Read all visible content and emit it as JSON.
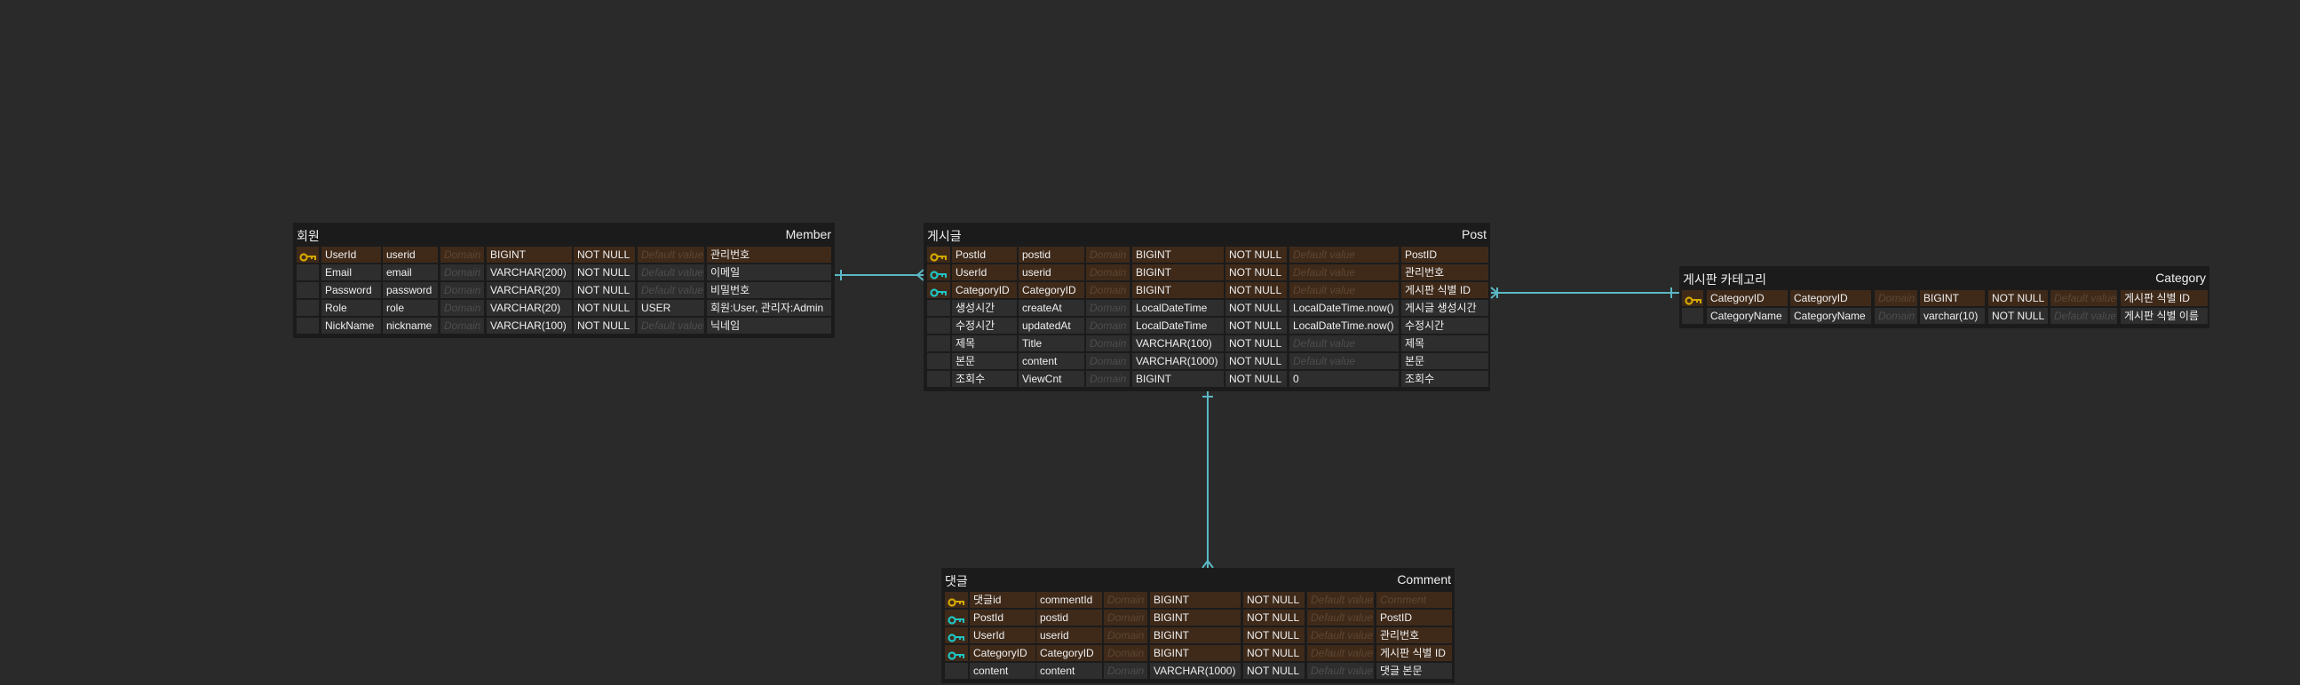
{
  "placeholders": {
    "domain": "Domain",
    "default": "Default value",
    "comment": "Comment"
  },
  "colors": {
    "background": "#2a2a2a",
    "table": "#1b1b1b",
    "key_row": "#3f2a1a",
    "pk_icon": "#d4a800",
    "fk_icon": "#1fc4c4",
    "relation_line": "#5bb8c4"
  },
  "tables": [
    {
      "id": "member",
      "logical_name": "회원",
      "physical_name": "Member",
      "rows": [
        {
          "key": "pk",
          "logical": "UserId",
          "physical": "userid",
          "type": "BIGINT",
          "null": "NOT NULL",
          "default": null,
          "comment": "관리번호"
        },
        {
          "key": null,
          "logical": "Email",
          "physical": "email",
          "type": "VARCHAR(200)",
          "null": "NOT NULL",
          "default": null,
          "comment": "이메일"
        },
        {
          "key": null,
          "logical": "Password",
          "physical": "password",
          "type": "VARCHAR(20)",
          "null": "NOT NULL",
          "default": null,
          "comment": "비밀번호"
        },
        {
          "key": null,
          "logical": "Role",
          "physical": "role",
          "type": "VARCHAR(20)",
          "null": "NOT NULL",
          "default": "USER",
          "comment": "회원:User, 관리자:Admin"
        },
        {
          "key": null,
          "logical": "NickName",
          "physical": "nickname",
          "type": "VARCHAR(100)",
          "null": "NOT NULL",
          "default": null,
          "comment": "닉네임"
        }
      ]
    },
    {
      "id": "post",
      "logical_name": "게시글",
      "physical_name": "Post",
      "rows": [
        {
          "key": "pk",
          "logical": "PostId",
          "physical": "postid",
          "type": "BIGINT",
          "null": "NOT NULL",
          "default": null,
          "comment": "PostID"
        },
        {
          "key": "fk",
          "logical": "UserId",
          "physical": "userid",
          "type": "BIGINT",
          "null": "NOT NULL",
          "default": null,
          "comment": "관리번호"
        },
        {
          "key": "fk",
          "logical": "CategoryID",
          "physical": "CategoryID",
          "type": "BIGINT",
          "null": "NOT NULL",
          "default": null,
          "comment": "게시판 식별 ID"
        },
        {
          "key": null,
          "logical": "생성시간",
          "physical": "createAt",
          "type": "LocalDateTime",
          "null": "NOT NULL",
          "default": "LocalDateTime.now()",
          "comment": "게시글 생성시간"
        },
        {
          "key": null,
          "logical": "수정시간",
          "physical": "updatedAt",
          "type": "LocalDateTime",
          "null": "NOT NULL",
          "default": "LocalDateTime.now()",
          "comment": "수정시간"
        },
        {
          "key": null,
          "logical": "제목",
          "physical": "Title",
          "type": "VARCHAR(100)",
          "null": "NOT NULL",
          "default": null,
          "comment": "제목"
        },
        {
          "key": null,
          "logical": "본문",
          "physical": "content",
          "type": "VARCHAR(1000)",
          "null": "NOT NULL",
          "default": null,
          "comment": "본문"
        },
        {
          "key": null,
          "logical": "조회수",
          "physical": "ViewCnt",
          "type": "BIGINT",
          "null": "NOT NULL",
          "default": "0",
          "comment": "조회수"
        }
      ]
    },
    {
      "id": "category",
      "logical_name": "게시판 카테고리",
      "physical_name": "Category",
      "rows": [
        {
          "key": "pk",
          "logical": "CategoryID",
          "physical": "CategoryID",
          "type": "BIGINT",
          "null": "NOT NULL",
          "default": null,
          "comment": "게시판 식별 ID"
        },
        {
          "key": null,
          "logical": "CategoryName",
          "physical": "CategoryName",
          "type": "varchar(10)",
          "null": "NOT NULL",
          "default": null,
          "comment": "게시판 식별 이름"
        }
      ]
    },
    {
      "id": "comment",
      "logical_name": "댓글",
      "physical_name": "Comment",
      "rows": [
        {
          "key": "pk",
          "logical": "댓글id",
          "physical": "commentId",
          "type": "BIGINT",
          "null": "NOT NULL",
          "default": null,
          "comment": null
        },
        {
          "key": "fk",
          "logical": "PostId",
          "physical": "postid",
          "type": "BIGINT",
          "null": "NOT NULL",
          "default": null,
          "comment": "PostID"
        },
        {
          "key": "fk",
          "logical": "UserId",
          "physical": "userid",
          "type": "BIGINT",
          "null": "NOT NULL",
          "default": null,
          "comment": "관리번호"
        },
        {
          "key": "fk",
          "logical": "CategoryID",
          "physical": "CategoryID",
          "type": "BIGINT",
          "null": "NOT NULL",
          "default": null,
          "comment": "게시판 식별 ID"
        },
        {
          "key": null,
          "logical": "content",
          "physical": "content",
          "type": "VARCHAR(1000)",
          "null": "NOT NULL",
          "default": null,
          "comment": "댓글 본문"
        }
      ]
    }
  ],
  "relations": [
    {
      "from": "member",
      "to": "post",
      "from_cardinality": "one",
      "to_cardinality": "many"
    },
    {
      "from": "category",
      "to": "post",
      "from_cardinality": "one",
      "to_cardinality": "many"
    },
    {
      "from": "post",
      "to": "comment",
      "from_cardinality": "one",
      "to_cardinality": "many"
    }
  ]
}
